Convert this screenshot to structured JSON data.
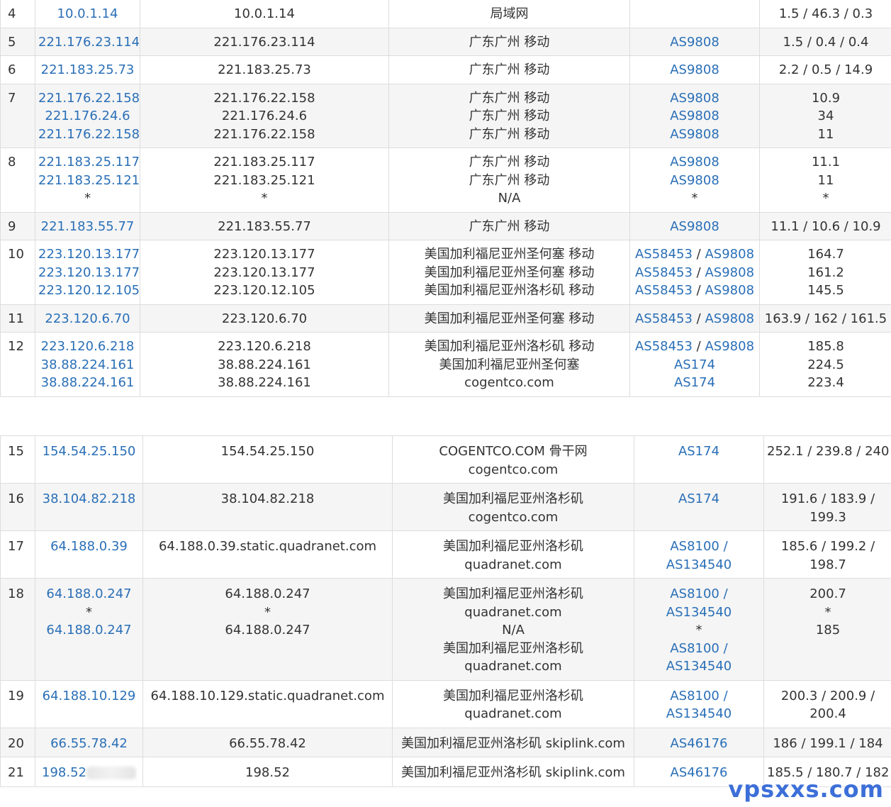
{
  "colors": {
    "link": "#2a6fb7",
    "text": "#333333",
    "border": "#dddddd",
    "stripe": "#f5f5f5",
    "watermark": "#3c6fd8"
  },
  "upper_rows": [
    {
      "hop": "4",
      "ips": [
        "10.0.1.14"
      ],
      "hosts": [
        "10.0.1.14"
      ],
      "locations": [
        "局域网"
      ],
      "asns": [
        ""
      ],
      "latency": [
        "1.5 / 46.3 / 0.3"
      ]
    },
    {
      "hop": "5",
      "ips": [
        "221.176.23.114"
      ],
      "hosts": [
        "221.176.23.114"
      ],
      "locations": [
        "广东广州 移动"
      ],
      "asns": [
        "AS9808"
      ],
      "latency": [
        "1.5 / 0.4 / 0.4"
      ]
    },
    {
      "hop": "6",
      "ips": [
        "221.183.25.73"
      ],
      "hosts": [
        "221.183.25.73"
      ],
      "locations": [
        "广东广州 移动"
      ],
      "asns": [
        "AS9808"
      ],
      "latency": [
        "2.2 / 0.5 / 14.9"
      ]
    },
    {
      "hop": "7",
      "ips": [
        "221.176.22.158",
        "221.176.24.6",
        "221.176.22.158"
      ],
      "hosts": [
        "221.176.22.158",
        "221.176.24.6",
        "221.176.22.158"
      ],
      "locations": [
        "广东广州 移动",
        "广东广州 移动",
        "广东广州 移动"
      ],
      "asns": [
        "AS9808",
        "AS9808",
        "AS9808"
      ],
      "latency": [
        "10.9",
        "34",
        "11"
      ]
    },
    {
      "hop": "8",
      "ips": [
        "221.183.25.117",
        "221.183.25.121",
        "*"
      ],
      "hosts": [
        "221.183.25.117",
        "221.183.25.121",
        "*"
      ],
      "locations": [
        "广东广州 移动",
        "广东广州 移动",
        "N/A"
      ],
      "asns": [
        "AS9808",
        "AS9808",
        "*"
      ],
      "latency": [
        "11.1",
        "11",
        "*"
      ]
    },
    {
      "hop": "9",
      "ips": [
        "221.183.55.77"
      ],
      "hosts": [
        "221.183.55.77"
      ],
      "locations": [
        "广东广州 移动"
      ],
      "asns": [
        "AS9808"
      ],
      "latency": [
        "11.1 / 10.6 / 10.9"
      ]
    },
    {
      "hop": "10",
      "ips": [
        "223.120.13.177",
        "223.120.13.177",
        "223.120.12.105"
      ],
      "hosts": [
        "223.120.13.177",
        "223.120.13.177",
        "223.120.12.105"
      ],
      "locations": [
        "美国加利福尼亚州圣何塞 移动",
        "美国加利福尼亚州圣何塞 移动",
        "美国加利福尼亚州洛杉矶 移动"
      ],
      "asns": [
        "AS58453 / AS9808",
        "AS58453 / AS9808",
        "AS58453 / AS9808"
      ],
      "latency": [
        "164.7",
        "161.2",
        "145.5"
      ]
    },
    {
      "hop": "11",
      "ips": [
        "223.120.6.70"
      ],
      "hosts": [
        "223.120.6.70"
      ],
      "locations": [
        "美国加利福尼亚州圣何塞 移动"
      ],
      "asns": [
        "AS58453 / AS9808"
      ],
      "latency": [
        "163.9 / 162 / 161.5"
      ]
    },
    {
      "hop": "12",
      "ips": [
        "223.120.6.218",
        "38.88.224.161",
        "38.88.224.161"
      ],
      "hosts": [
        "223.120.6.218",
        "38.88.224.161",
        "38.88.224.161"
      ],
      "locations": [
        "美国加利福尼亚州洛杉矶 移动",
        "美国加利福尼亚州圣何塞",
        "cogentco.com"
      ],
      "asns": [
        "AS58453 / AS9808",
        "AS174",
        "AS174"
      ],
      "latency": [
        "185.8",
        "224.5",
        "223.4"
      ]
    }
  ],
  "lower_rows": [
    {
      "hop": "15",
      "ips": [
        "154.54.25.150"
      ],
      "hosts": [
        "154.54.25.150"
      ],
      "locations": [
        "COGENTCO.COM 骨干网",
        "cogentco.com"
      ],
      "asns": [
        "AS174"
      ],
      "latency": [
        "252.1 / 239.8 / 240"
      ]
    },
    {
      "hop": "16",
      "ips": [
        "38.104.82.218"
      ],
      "hosts": [
        "38.104.82.218"
      ],
      "locations": [
        "美国加利福尼亚州洛杉矶",
        "cogentco.com"
      ],
      "asns": [
        "AS174"
      ],
      "latency": [
        "191.6 / 183.9 /",
        "199.3"
      ]
    },
    {
      "hop": "17",
      "ips": [
        "64.188.0.39"
      ],
      "hosts": [
        "64.188.0.39.static.quadranet.com"
      ],
      "locations": [
        "美国加利福尼亚州洛杉矶",
        "quadranet.com"
      ],
      "asns": [
        "AS8100 /",
        "AS134540"
      ],
      "latency": [
        "185.6 / 199.2 /",
        "198.7"
      ]
    },
    {
      "hop": "18",
      "ips": [
        "64.188.0.247",
        "*",
        "64.188.0.247"
      ],
      "hosts": [
        "64.188.0.247",
        "*",
        "64.188.0.247"
      ],
      "locations": [
        "美国加利福尼亚州洛杉矶",
        "quadranet.com",
        "N/A",
        "美国加利福尼亚州洛杉矶",
        "quadranet.com"
      ],
      "asns": [
        "AS8100 /",
        "AS134540",
        "*",
        "AS8100 /",
        "AS134540"
      ],
      "latency": [
        "200.7",
        "*",
        "185"
      ]
    },
    {
      "hop": "19",
      "ips": [
        "64.188.10.129"
      ],
      "hosts": [
        "64.188.10.129.static.quadranet.com"
      ],
      "locations": [
        "美国加利福尼亚州洛杉矶",
        "quadranet.com"
      ],
      "asns": [
        "AS8100 /",
        "AS134540"
      ],
      "latency": [
        "200.3 / 200.9 /",
        "200.4"
      ]
    },
    {
      "hop": "20",
      "ips": [
        "66.55.78.42"
      ],
      "hosts": [
        "66.55.78.42"
      ],
      "locations": [
        "美国加利福尼亚州洛杉矶 skiplink.com"
      ],
      "asns": [
        "AS46176"
      ],
      "latency": [
        "186 / 199.1 / 184"
      ]
    },
    {
      "hop": "21",
      "ips": [
        "198.52"
      ],
      "hosts": [
        "198.52"
      ],
      "locations": [
        "美国加利福尼亚州洛杉矶 skiplink.com"
      ],
      "asns": [
        "AS46176"
      ],
      "latency": [
        "185.5 / 180.7 / 182"
      ],
      "redacted": true
    }
  ],
  "watermark": "vpsxxs.com"
}
